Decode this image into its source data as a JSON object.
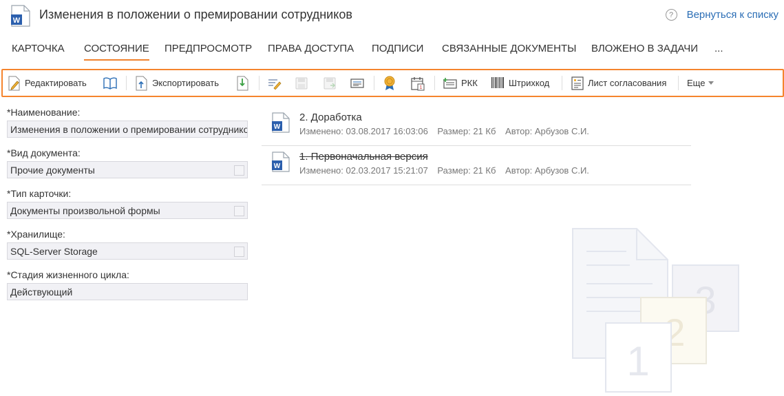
{
  "header": {
    "title": "Изменения в положении о премировании сотрудников",
    "back_link": "Вернуться к списку",
    "doc_icon": "word-document-icon",
    "help_icon": "help-icon"
  },
  "tabs": [
    {
      "label": "КАРТОЧКА",
      "active": false
    },
    {
      "label": "СОСТОЯНИЕ",
      "active": true
    },
    {
      "label": "ПРЕДПРОСМОТР",
      "active": false
    },
    {
      "label": "ПРАВА ДОСТУПА",
      "active": false
    },
    {
      "label": "ПОДПИСИ",
      "active": false
    },
    {
      "label": "СВЯЗАННЫЕ ДОКУМЕНТЫ",
      "active": false
    },
    {
      "label": "ВЛОЖЕНО В ЗАДАЧИ",
      "active": false
    },
    {
      "label": "...",
      "active": false
    }
  ],
  "toolbar": {
    "edit": "Редактировать",
    "export": "Экспортировать",
    "rkk": "РКК",
    "barcode": "Штрихкод",
    "approval_sheet": "Лист согласования",
    "more": "Еще",
    "accent_color": "#f5842d"
  },
  "form": {
    "name_label": "*Наименование:",
    "name_value": "Изменения в положении о премировании сотрудников",
    "doc_type_label": "*Вид документа:",
    "doc_type_value": "Прочие документы",
    "card_type_label": "*Тип карточки:",
    "card_type_value": "Документы произвольной формы",
    "storage_label": "*Хранилище:",
    "storage_value": "SQL-Server Storage",
    "stage_label": "*Стадия жизненного цикла:",
    "stage_value": "Действующий"
  },
  "versions": [
    {
      "title": "2. Доработка",
      "modified": "Изменено: 03.08.2017 16:03:06",
      "size": "Размер: 21 Кб",
      "author": "Автор: Арбузов С.И.",
      "struck": false
    },
    {
      "title": "1. Первоначальная версия",
      "modified": "Изменено: 02.03.2017 15:21:07",
      "size": "Размер: 21 Кб",
      "author": "Автор: Арбузов С.И.",
      "struck": true
    }
  ]
}
